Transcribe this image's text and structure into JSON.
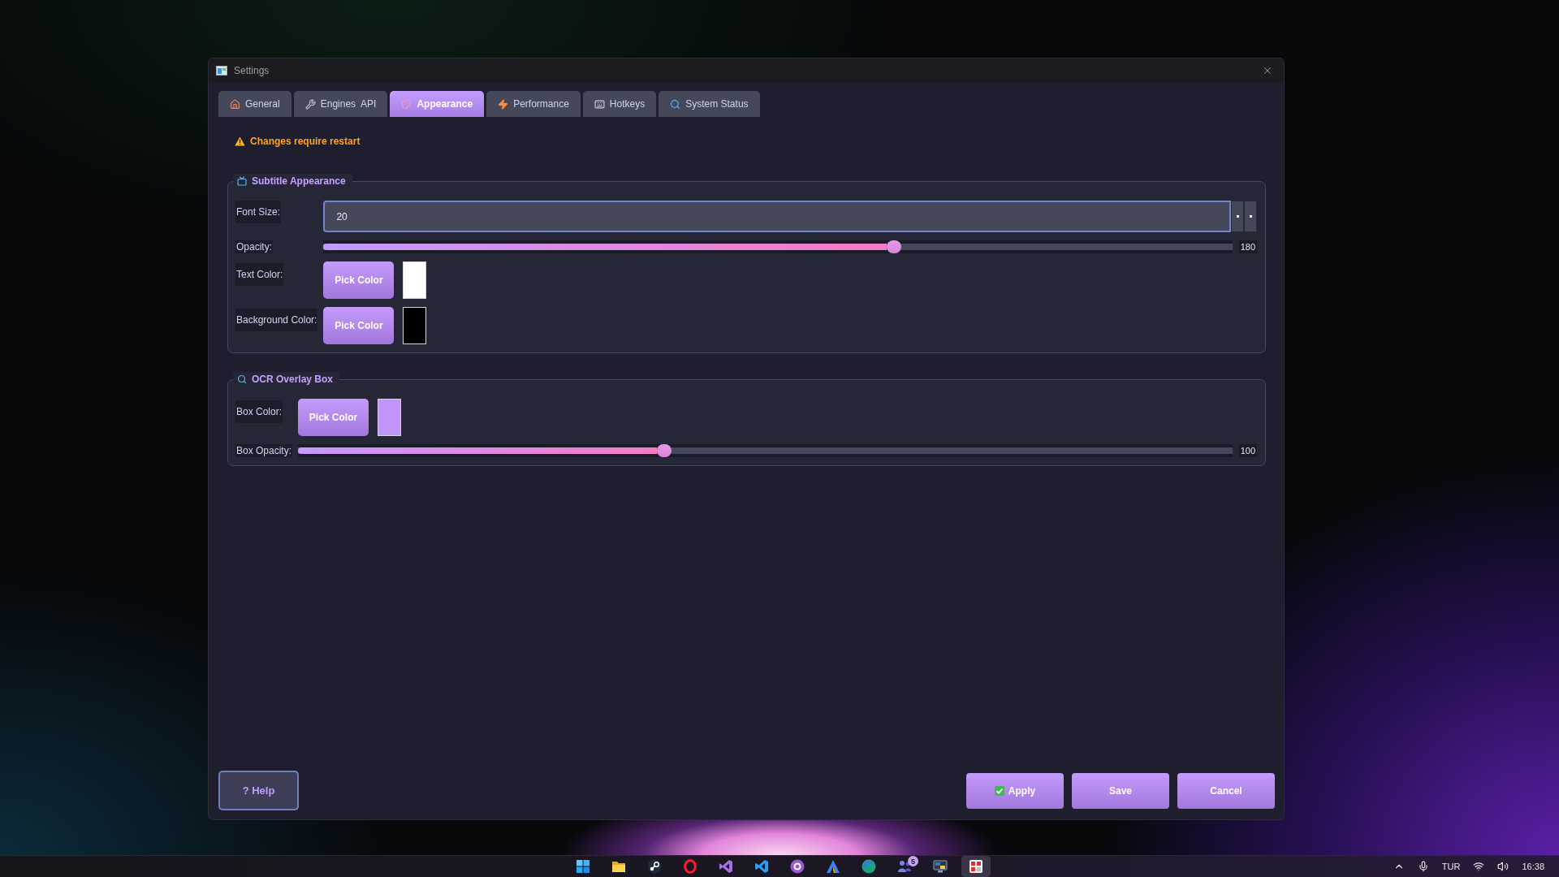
{
  "window": {
    "title": "Settings"
  },
  "tabs": [
    {
      "label": "General",
      "selected": false
    },
    {
      "label": "Engines  API",
      "selected": false
    },
    {
      "label": "Appearance",
      "selected": true
    },
    {
      "label": "Performance",
      "selected": false
    },
    {
      "label": "Hotkeys",
      "selected": false
    },
    {
      "label": "System Status",
      "selected": false
    }
  ],
  "notice": "Changes require restart",
  "groups": [
    {
      "title": "Subtitle Appearance",
      "rows": [
        {
          "kind": "spin",
          "label": "Font Size:",
          "value": "20"
        },
        {
          "kind": "slider",
          "label": "Opacity:",
          "level": 0.63,
          "reading": "180"
        },
        {
          "kind": "color",
          "label": "Text Color:",
          "button": "Pick Color",
          "color": "#ffffff"
        },
        {
          "kind": "color",
          "label": "Background Color:",
          "button": "Pick Color",
          "color": "#000000"
        }
      ]
    },
    {
      "title": "OCR Overlay Box",
      "rows": [
        {
          "kind": "color",
          "label": "Box Color:",
          "button": "Pick Color",
          "color": "#c195fa"
        },
        {
          "kind": "slider",
          "label": "Box Opacity:",
          "level": 0.39,
          "reading": "100"
        }
      ]
    }
  ],
  "footer": {
    "help": "? Help",
    "buttons": [
      {
        "kind": "apply",
        "label": "Apply"
      },
      {
        "kind": "save",
        "label": "Save"
      },
      {
        "kind": "cancel",
        "label": "Cancel"
      }
    ]
  },
  "taskbar": {
    "apps": [
      {
        "selected": false
      },
      {
        "selected": false
      },
      {
        "selected": false
      },
      {
        "selected": false
      },
      {
        "selected": false
      },
      {
        "selected": false
      },
      {
        "selected": false
      },
      {
        "selected": false
      },
      {
        "selected": false
      },
      {
        "selected": false,
        "badge": "5"
      },
      {
        "selected": false
      },
      {
        "selected": true
      }
    ],
    "language": "TUR",
    "clock": "16:38"
  }
}
